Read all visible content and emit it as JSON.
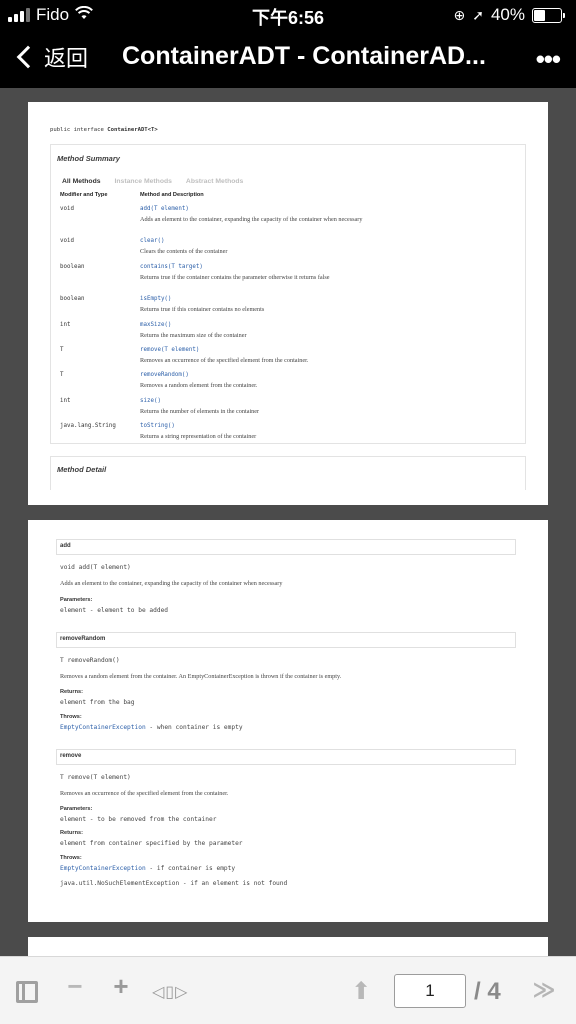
{
  "status": {
    "carrier": "Fido",
    "time": "下午6:56",
    "battery": "40%",
    "battery_level": 0.4
  },
  "nav": {
    "back_label": "返回",
    "title": "ContainerADT - ContainerAD...",
    "more": "•••"
  },
  "doc": {
    "page1": {
      "declaration_prefix": "public interface ",
      "declaration_name": "ContainerADT<T>",
      "summary_title": "Method Summary",
      "tabs": [
        "All Methods",
        "Instance Methods",
        "Abstract Methods"
      ],
      "col_type": "Modifier and Type",
      "col_method": "Method and Description",
      "rows": [
        {
          "type": "void",
          "sig": "add(T element)",
          "desc": "Adds an element to the container, expanding the capacity of the container when necessary"
        },
        {
          "type": "void",
          "sig": "clear()",
          "desc": "Clears the contents of the container"
        },
        {
          "type": "boolean",
          "sig": "contains(T target)",
          "desc": "Returns true if the container contains the parameter otherwise it returns false"
        },
        {
          "type": "boolean",
          "sig": "isEmpty()",
          "desc": "Returns true if this container contains no elements"
        },
        {
          "type": "int",
          "sig": "maxSize()",
          "desc": "Returns the maximum size of the container"
        },
        {
          "type": "T",
          "sig": "remove(T element)",
          "desc": "Removes an occurrence of the specified element from the container."
        },
        {
          "type": "T",
          "sig": "removeRandom()",
          "desc": "Removes a random element from the container."
        },
        {
          "type": "int",
          "sig": "size()",
          "desc": "Returns the number of elements in the container"
        },
        {
          "type": "java.lang.String",
          "sig": "toString()",
          "desc": "Returns a string representation of the container"
        }
      ],
      "detail_title": "Method Detail"
    },
    "page2": {
      "add_header": "add",
      "add_sig": "void add(T element)",
      "add_desc": "Adds an element to the container, expanding the capacity of the container when necessary",
      "params_label": "Parameters:",
      "add_param": "element - element to be added",
      "rr_header": "removeRandom",
      "rr_sig": "T removeRandom()",
      "rr_desc": "Removes a random element from the container. An EmptyContainerException is thrown if the container is empty.",
      "returns_label": "Returns:",
      "rr_returns": "element from the bag",
      "throws_label": "Throws:",
      "rr_throws_name": "EmptyContainerException",
      "rr_throws_text": " - when container is empty",
      "rm_header": "remove",
      "rm_sig": "T remove(T element)",
      "rm_desc": "Removes an occurrence of the specified element from the container.",
      "rm_param": "element - to be removed from the container",
      "rm_returns": "element from container specified by the parameter",
      "rm_throws1_name": "EmptyContainerException",
      "rm_throws1_text": " - if container is empty",
      "rm_throws2": "java.util.NoSuchElementException - if an element is not found"
    }
  },
  "toolbar": {
    "zoom_out": "−",
    "zoom_in": "+",
    "fit": "◁▯▷",
    "prev": "⬆",
    "current_page": "1",
    "total_pages": "/ 4",
    "next": "≫"
  }
}
